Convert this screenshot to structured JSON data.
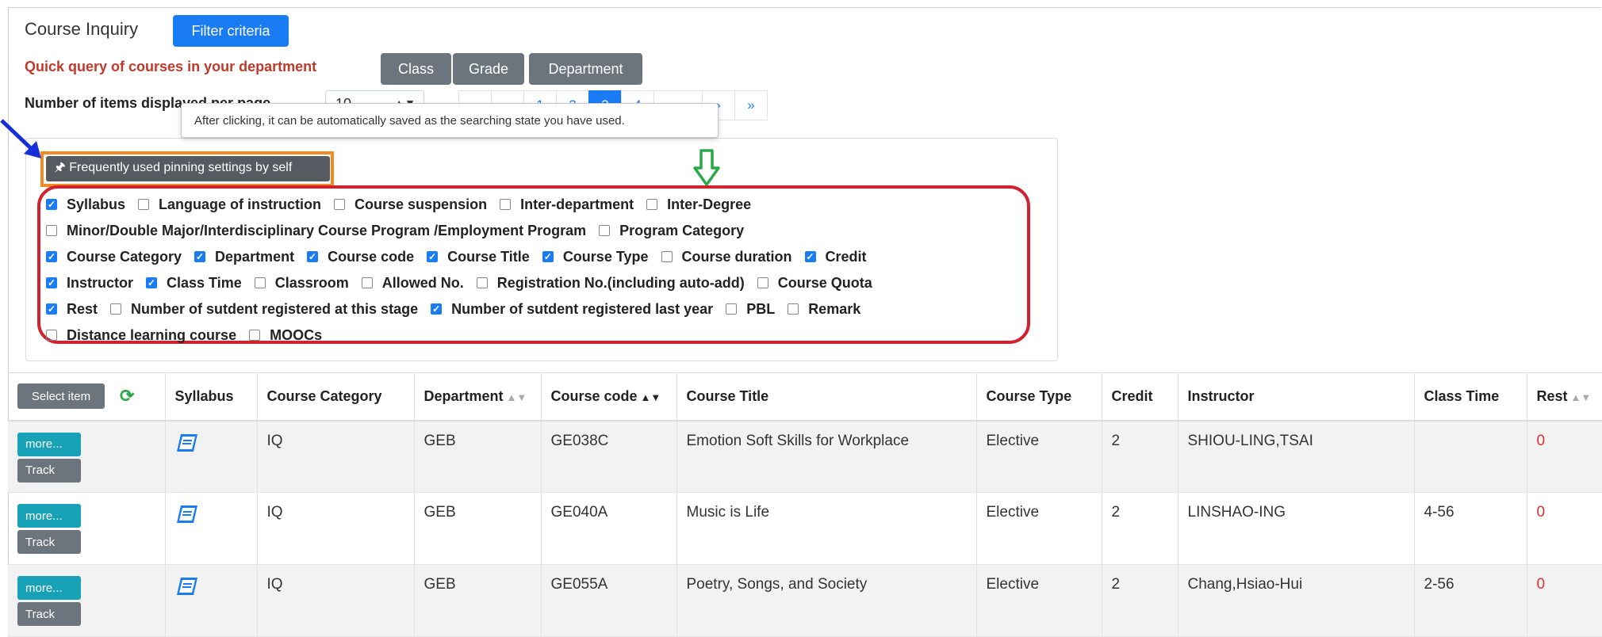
{
  "header": {
    "title": "Course Inquiry",
    "filter_button": "Filter criteria",
    "quick_query_label": "Quick query of courses in your department",
    "quick_buttons": [
      "Class",
      "Grade",
      "Department"
    ],
    "per_page_label": "Number of items displayed per page",
    "per_page_value": "10"
  },
  "pagination": {
    "first": "«",
    "prev": "‹",
    "pages": [
      "1",
      "2",
      "3",
      "4"
    ],
    "current": "3",
    "ellipsis": "",
    "next": "›",
    "last": "»"
  },
  "tooltip": "After clicking, it can be automatically saved as the searching state you have used.",
  "pin_button": "🖈 Frequently used pinning settings by self",
  "column_options": [
    [
      {
        "label": "Syllabus",
        "checked": true
      },
      {
        "label": "Language of instruction",
        "checked": false
      },
      {
        "label": "Course suspension",
        "checked": false
      },
      {
        "label": "Inter-department",
        "checked": false
      },
      {
        "label": "Inter-Degree",
        "checked": false
      }
    ],
    [
      {
        "label": "Minor/Double Major/Interdisciplinary Course Program /Employment Program",
        "checked": false
      },
      {
        "label": "Program Category",
        "checked": false
      }
    ],
    [
      {
        "label": "Course Category",
        "checked": true
      },
      {
        "label": "Department",
        "checked": true
      },
      {
        "label": "Course code",
        "checked": true
      },
      {
        "label": "Course Title",
        "checked": true
      },
      {
        "label": "Course Type",
        "checked": true
      },
      {
        "label": "Course duration",
        "checked": false
      },
      {
        "label": "Credit",
        "checked": true
      }
    ],
    [
      {
        "label": "Instructor",
        "checked": true
      },
      {
        "label": "Class Time",
        "checked": true
      },
      {
        "label": "Classroom",
        "checked": false
      },
      {
        "label": "Allowed No.",
        "checked": false
      },
      {
        "label": "Registration No.(including auto-add)",
        "checked": false
      },
      {
        "label": "Course Quota",
        "checked": false
      }
    ],
    [
      {
        "label": "Rest",
        "checked": true
      },
      {
        "label": "Number of sutdent registered at this stage",
        "checked": false
      },
      {
        "label": "Number of sutdent registered last year",
        "checked": true
      },
      {
        "label": "PBL",
        "checked": false
      },
      {
        "label": "Remark",
        "checked": false
      }
    ],
    [
      {
        "label": "Distance learning course",
        "checked": false
      },
      {
        "label": "MOOCs",
        "checked": false
      }
    ]
  ],
  "table": {
    "select_item_label": "Select item",
    "headers": {
      "syllabus": "Syllabus",
      "course_category": "Course Category",
      "department": "Department",
      "course_code": "Course code",
      "course_title": "Course Title",
      "course_type": "Course Type",
      "credit": "Credit",
      "instructor": "Instructor",
      "class_time": "Class Time",
      "rest": "Rest"
    },
    "more_label": "more...",
    "track_label": "Track",
    "rows": [
      {
        "category": "IQ",
        "department": "GEB",
        "code": "GE038C",
        "title": "Emotion Soft Skills for Workplace",
        "type": "Elective",
        "credit": "2",
        "instructor": "SHIOU-LING,TSAI",
        "class_time": "",
        "rest": "0"
      },
      {
        "category": "IQ",
        "department": "GEB",
        "code": "GE040A",
        "title": "Music is Life",
        "type": "Elective",
        "credit": "2",
        "instructor": "LINSHAO-ING",
        "class_time": "4-56",
        "rest": "0"
      },
      {
        "category": "IQ",
        "department": "GEB",
        "code": "GE055A",
        "title": "Poetry, Songs, and Society",
        "type": "Elective",
        "credit": "2",
        "instructor": "Chang,Hsiao-Hui",
        "class_time": "2-56",
        "rest": "0"
      }
    ]
  },
  "colors": {
    "primary": "#1a7cf5",
    "secondary": "#6c757d",
    "info": "#17a2b8",
    "quick_label": "#c0392b",
    "highlight_orange": "#f08a24",
    "highlight_red": "#d0222f",
    "annotation_green": "#2aa84a",
    "annotation_blue": "#1530d8"
  }
}
